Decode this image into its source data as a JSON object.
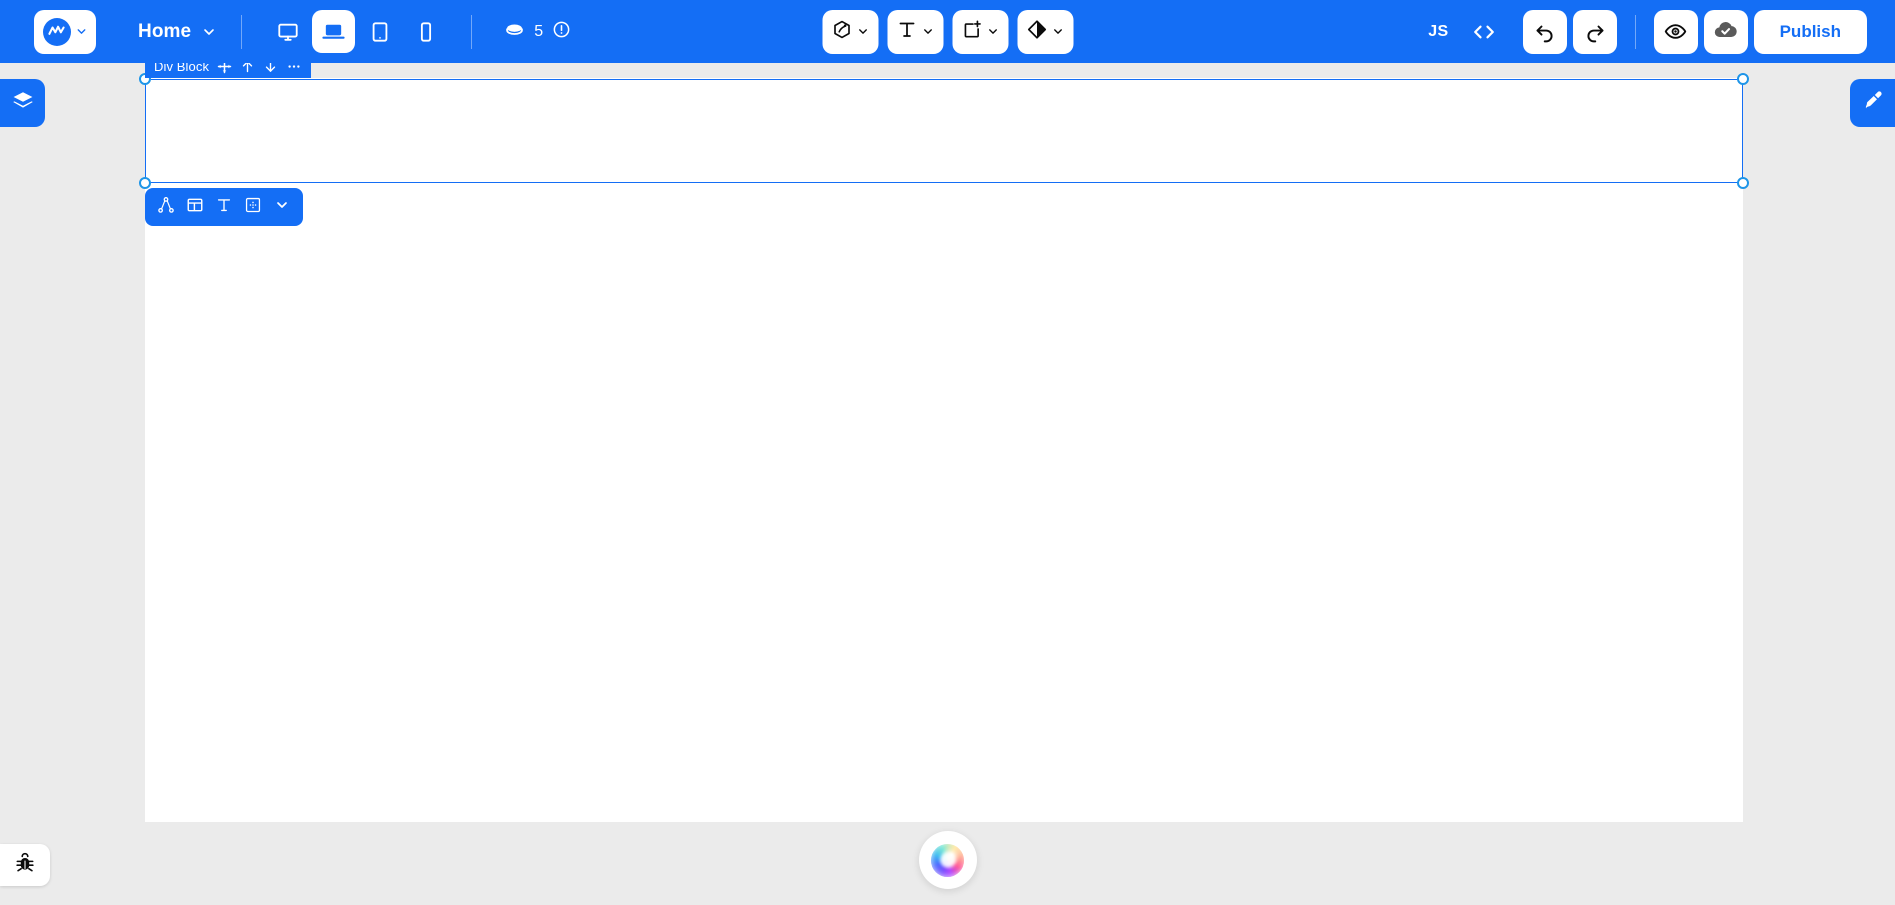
{
  "app": {
    "name": "Webflow Designer",
    "brand_color": "#146ef5"
  },
  "topbar": {
    "logo": {
      "icon": "webflow-logo-icon",
      "chevron": "chevron-down-icon"
    },
    "page_menu": {
      "label": "Home",
      "chevron": "chevron-down-icon"
    },
    "breakpoints": [
      {
        "name": "desktop-xl",
        "icon": "monitor-icon",
        "active": false
      },
      {
        "name": "desktop",
        "icon": "laptop-icon",
        "active": true
      },
      {
        "name": "tablet",
        "icon": "tablet-icon",
        "active": false
      },
      {
        "name": "mobile",
        "icon": "phone-icon",
        "active": false
      }
    ],
    "credits": {
      "icon": "coin-icon",
      "count": "5",
      "info_icon": "alert-circle-icon"
    },
    "tools": [
      {
        "name": "components",
        "icon": "component-hexagon-icon",
        "chevron": "chevron-down-icon"
      },
      {
        "name": "text",
        "icon": "text-t-icon",
        "chevron": "chevron-down-icon"
      },
      {
        "name": "add-element",
        "icon": "add-box-icon",
        "chevron": "chevron-down-icon"
      },
      {
        "name": "variables",
        "icon": "contrast-diamond-icon",
        "chevron": "chevron-down-icon"
      }
    ],
    "js_label": "JS",
    "code_icon": "code-brackets-icon",
    "undo": {
      "label": "Undo",
      "icon": "undo-arrow-icon"
    },
    "redo": {
      "label": "Redo",
      "icon": "redo-arrow-icon"
    },
    "preview": {
      "label": "Preview",
      "icon": "eye-icon"
    },
    "saved": {
      "label": "Saved",
      "icon": "cloud-check-icon"
    },
    "publish": {
      "label": "Publish"
    }
  },
  "panels": {
    "left_tab": {
      "name": "navigator",
      "icon": "layers-stack-icon"
    },
    "right_tab": {
      "name": "style",
      "icon": "paintbrush-icon"
    }
  },
  "selection": {
    "label": "Div Block",
    "actions": [
      {
        "name": "move",
        "icon": "move-arrows-icon"
      },
      {
        "name": "move-up",
        "icon": "arrow-up-icon"
      },
      {
        "name": "move-down",
        "icon": "arrow-down-icon"
      },
      {
        "name": "more",
        "icon": "ellipsis-icon"
      }
    ]
  },
  "quick_add": {
    "buttons": [
      {
        "name": "component",
        "icon": "node-hierarchy-icon"
      },
      {
        "name": "layout",
        "icon": "layout-columns-icon"
      },
      {
        "name": "text",
        "icon": "text-t-icon"
      },
      {
        "name": "div-block",
        "icon": "dotted-box-icon"
      },
      {
        "name": "more",
        "icon": "chevron-down-icon"
      }
    ]
  },
  "footer": {
    "bug": {
      "name": "report-bug",
      "icon": "bug-icon"
    },
    "ai": {
      "name": "ai-assistant",
      "icon": "ai-orb-icon"
    }
  }
}
